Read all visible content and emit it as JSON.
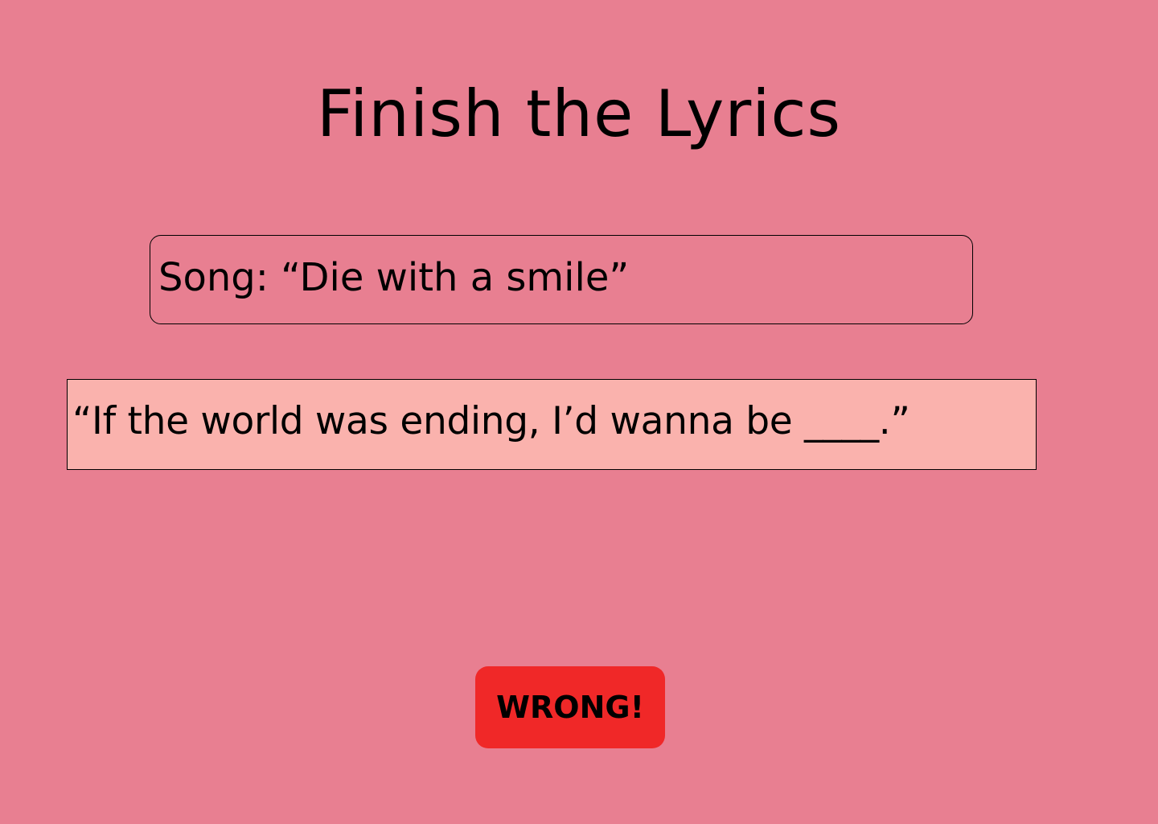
{
  "header": {
    "title": "Finish the Lyrics"
  },
  "song": {
    "text": "Song: “Die with a smile”"
  },
  "lyric": {
    "text": "“If the world was ending, I’d wanna be ____.”"
  },
  "result_button": {
    "label": "WRONG!"
  },
  "colors": {
    "background": "#e87f91",
    "lyric_box_fill": "#fab2ad",
    "button_fill": "#f02828",
    "text": "#000000"
  }
}
